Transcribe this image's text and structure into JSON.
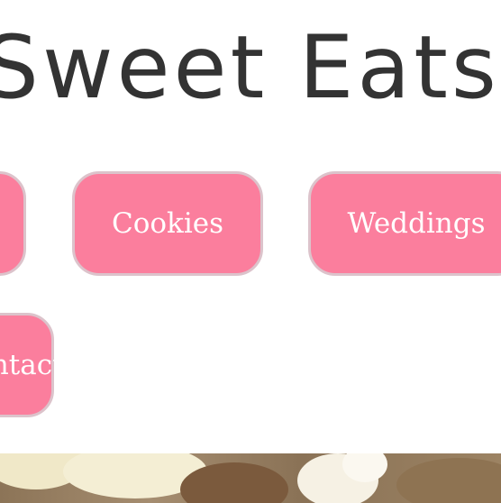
{
  "site": {
    "title": "Sweet Eats"
  },
  "nav": {
    "items": [
      {
        "label": ""
      },
      {
        "label": "Cookies"
      },
      {
        "label": "Weddings"
      },
      {
        "label": "Contact"
      }
    ]
  },
  "colors": {
    "button_background": "#fb7e9d",
    "button_border": "#dcc3cb",
    "button_text": "#ffffff",
    "title_text": "#333333",
    "page_background": "#ffffff"
  }
}
